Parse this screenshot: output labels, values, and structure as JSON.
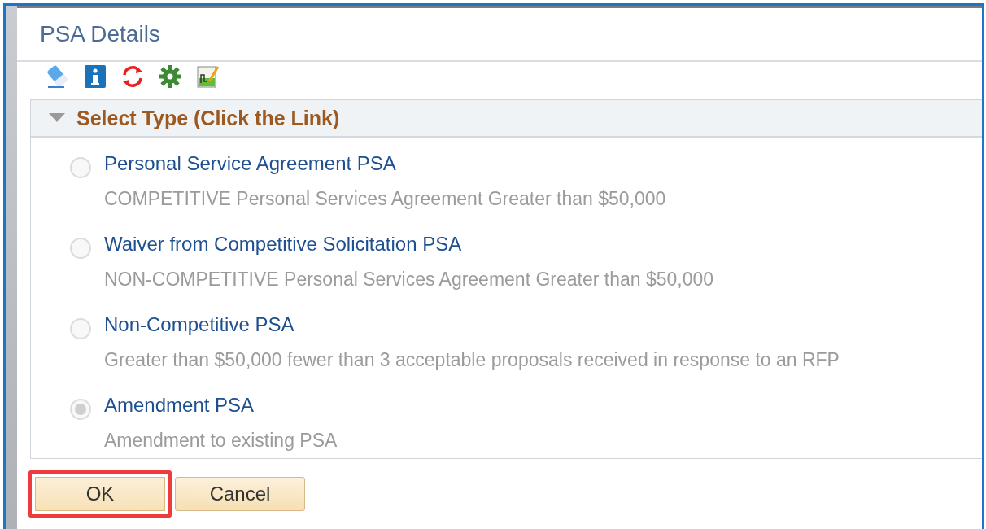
{
  "dialog": {
    "title": "PSA Details"
  },
  "toolbar": [
    {
      "kind": "eraser"
    },
    {
      "kind": "info"
    },
    {
      "kind": "refresh"
    },
    {
      "kind": "settings"
    },
    {
      "kind": "chart"
    }
  ],
  "section": {
    "title": "Select Type (Click the Link)",
    "expanded": true
  },
  "options": [
    {
      "label": "Personal Service Agreement PSA",
      "description": "COMPETITIVE Personal Services Agreement Greater than $50,000",
      "selected": false
    },
    {
      "label": "Waiver from Competitive Solicitation PSA",
      "description": "NON-COMPETITIVE Personal Services Agreement Greater than $50,000",
      "selected": false
    },
    {
      "label": "Non-Competitive PSA",
      "description": "Greater than $50,000 fewer than 3 acceptable proposals received in response to an RFP",
      "selected": false
    },
    {
      "label": "Amendment PSA",
      "description": "Amendment to existing PSA",
      "selected": true
    }
  ],
  "buttons": [
    {
      "label": "OK",
      "highlighted": true
    },
    {
      "label": "Cancel",
      "highlighted": false
    }
  ]
}
